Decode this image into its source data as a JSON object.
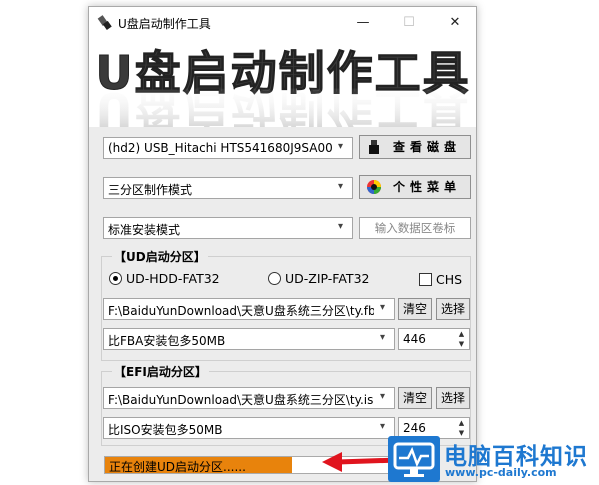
{
  "window": {
    "title": "U盘启动制作工具",
    "minimize": "—",
    "maximize": "☐",
    "close": "✕"
  },
  "banner": {
    "text": "U盘启动制作工具"
  },
  "disk_select": {
    "value": "(hd2) USB_Hitachi HTS541680J9SA00 _7"
  },
  "check_disk_button": {
    "label": "查看磁盘"
  },
  "mode_select": {
    "value": "三分区制作模式"
  },
  "menu_button": {
    "label": "个性菜单"
  },
  "install_mode_select": {
    "value": "标准安装模式"
  },
  "volume_label_input": {
    "placeholder": "输入数据区卷标"
  },
  "ud_group": {
    "title": "【UD启动分区】",
    "radio_hdd": "UD-HDD-FAT32",
    "radio_zip": "UD-ZIP-FAT32",
    "radio_hdd_selected": true,
    "chs_label": "CHS",
    "chs_checked": false,
    "file_path": "F:\\BaiduYunDownload\\天意U盘系统三分区\\ty.fb",
    "clear_label": "清空",
    "choose_label": "选择",
    "size_option": "比FBA安装包多50MB",
    "size_value": "446"
  },
  "efi_group": {
    "title": "【EFI启动分区】",
    "file_path": "F:\\BaiduYunDownload\\天意U盘系统三分区\\ty.iso",
    "clear_label": "清空",
    "choose_label": "选择",
    "size_option": "比ISO安装包多50MB",
    "size_value": "246"
  },
  "status": {
    "text": "正在创建UD启动分区......",
    "progress": 0.65,
    "color": "#e8830c"
  },
  "watermark": {
    "name": "电脑百科知识",
    "url": "www.pc-daily.com",
    "color": "#1e78d0"
  },
  "colors": {
    "accent_orange": "#e8830c",
    "arrow_red": "#e0141e"
  }
}
